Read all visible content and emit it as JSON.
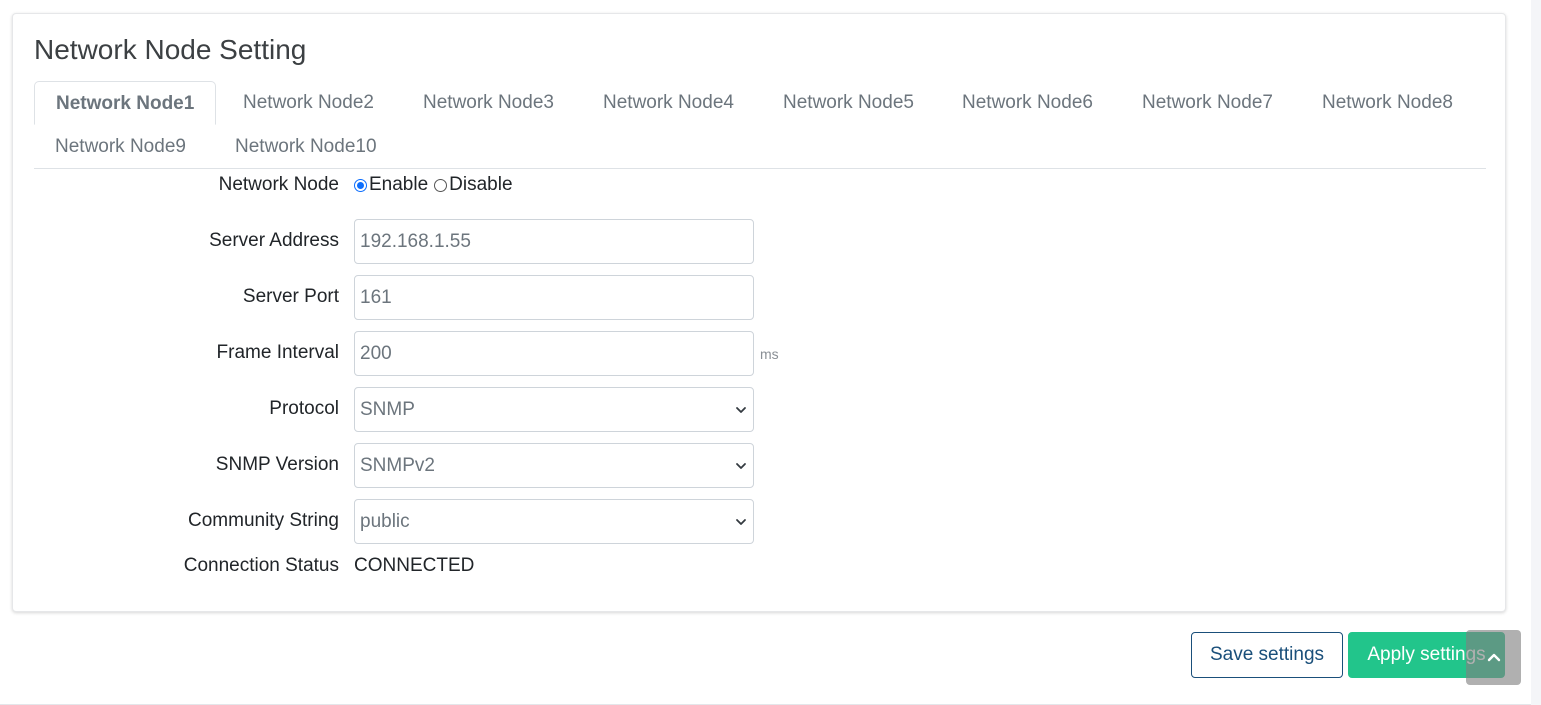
{
  "card": {
    "title": "Network Node Setting"
  },
  "tabs": [
    {
      "label": "Network Node1",
      "active": true
    },
    {
      "label": "Network Node2"
    },
    {
      "label": "Network Node3"
    },
    {
      "label": "Network Node4"
    },
    {
      "label": "Network Node5"
    },
    {
      "label": "Network Node6"
    },
    {
      "label": "Network Node7"
    },
    {
      "label": "Network Node8"
    },
    {
      "label": "Network Node9"
    },
    {
      "label": "Network Node10"
    }
  ],
  "form": {
    "network_node": {
      "label": "Network Node",
      "options": [
        "Enable",
        "Disable"
      ],
      "selected": "Enable"
    },
    "server_address": {
      "label": "Server Address",
      "value": "192.168.1.55"
    },
    "server_port": {
      "label": "Server Port",
      "value": "161"
    },
    "frame_interval": {
      "label": "Frame Interval",
      "value": "200",
      "unit": "ms"
    },
    "protocol": {
      "label": "Protocol",
      "value": "SNMP"
    },
    "snmp_version": {
      "label": "SNMP Version",
      "value": "SNMPv2"
    },
    "community_string": {
      "label": "Community String",
      "value": "public"
    },
    "connection_status": {
      "label": "Connection Status",
      "value": "CONNECTED"
    }
  },
  "buttons": {
    "save": "Save settings",
    "apply": "Apply settings"
  },
  "icons": {
    "select_chevron": "chevron-down-icon",
    "scroll_top": "chevron-up-icon"
  },
  "colors": {
    "apply_button": "#22c58b",
    "save_button_border": "#1a4f7a",
    "radio_checked": "#0d6efd"
  }
}
